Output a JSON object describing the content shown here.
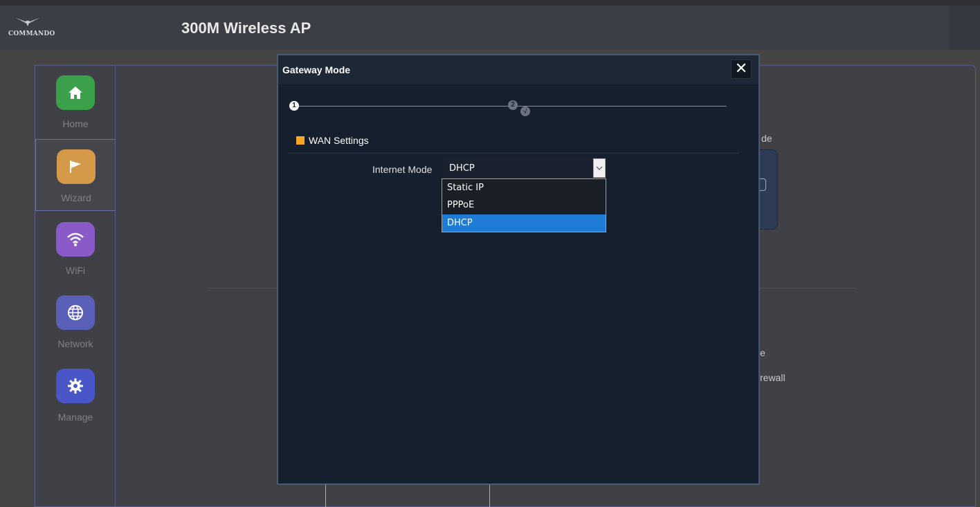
{
  "header": {
    "logo_text": "COMMANDO",
    "app_title": "300M Wireless AP"
  },
  "sidebar": {
    "items": [
      {
        "label": "Home",
        "icon": "home-icon",
        "color": "#3aa14a"
      },
      {
        "label": "Wizard",
        "icon": "flag-icon",
        "color": "#d49a4a"
      },
      {
        "label": "WiFi",
        "icon": "wifi-icon",
        "color": "#8a5bc8"
      },
      {
        "label": "Network",
        "icon": "globe-icon",
        "color": "#5a5fb8"
      },
      {
        "label": "Manage",
        "icon": "gear-icon",
        "color": "#4a55c8"
      }
    ],
    "active": "Wizard"
  },
  "background": {
    "partial_text_1": "de",
    "partial_text_2": "e",
    "partial_text_3": "rewall"
  },
  "modal": {
    "title": "Gateway Mode",
    "close_label": "✕",
    "steps": [
      "1",
      "2",
      "√"
    ],
    "current_step": 1,
    "section_title": "WAN Settings",
    "section_color": "#f5a623",
    "field_label": "Internet Mode",
    "select_value": "DHCP",
    "options": [
      "Static IP",
      "PPPoE",
      "DHCP"
    ],
    "selected_option": "DHCP",
    "highlight_color": "#1e7bd6"
  }
}
